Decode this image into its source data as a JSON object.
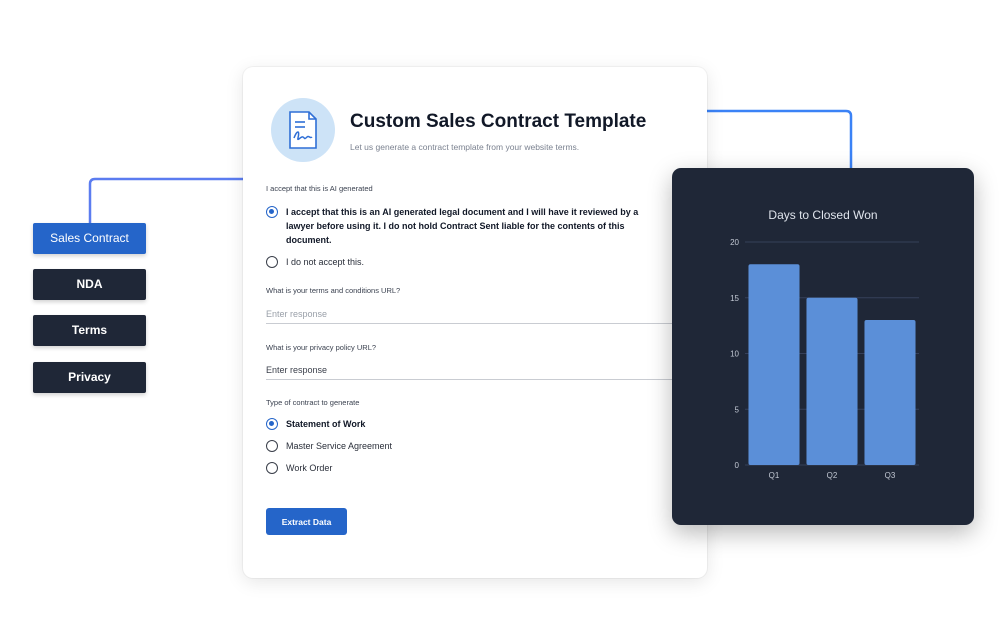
{
  "nav": {
    "items": [
      {
        "label": "Sales Contract",
        "active": true
      },
      {
        "label": "NDA",
        "active": false
      },
      {
        "label": "Terms",
        "active": false
      },
      {
        "label": "Privacy",
        "active": false
      }
    ]
  },
  "form": {
    "icon": "document-signature-icon",
    "title": "Custom Sales Contract Template",
    "subtitle": "Let us generate a contract template from your website terms.",
    "q1": {
      "label": "I accept that this is AI generated",
      "options": [
        {
          "label": "I accept that this is an AI generated legal document and I will have it reviewed by a lawyer before using it. I do not hold Contract Sent liable for the contents of this document.",
          "checked": true
        },
        {
          "label": "I do not accept this.",
          "checked": false
        }
      ]
    },
    "q2": {
      "label": "What is your terms and conditions URL?",
      "placeholder": "Enter response"
    },
    "q3": {
      "label": "What is your privacy policy URL?",
      "placeholder": "Enter response"
    },
    "q4": {
      "label": "Type of contract to generate",
      "options": [
        {
          "label": "Statement of Work",
          "checked": true
        },
        {
          "label": "Master Service Agreement",
          "checked": false
        },
        {
          "label": "Work Order",
          "checked": false
        }
      ]
    },
    "submit_label": "Extract Data"
  },
  "colors": {
    "accent": "#2565c9",
    "dark_panel": "#1f2737",
    "bar": "#5b8fd8"
  },
  "chart_data": {
    "type": "bar",
    "title": "Days to Closed Won",
    "categories": [
      "Q1",
      "Q2",
      "Q3"
    ],
    "values": [
      18,
      15,
      13
    ],
    "ylim": [
      0,
      20
    ],
    "yticks": [
      0,
      5,
      10,
      15,
      20
    ],
    "xlabel": "",
    "ylabel": "",
    "grid": true,
    "legend": "none"
  }
}
